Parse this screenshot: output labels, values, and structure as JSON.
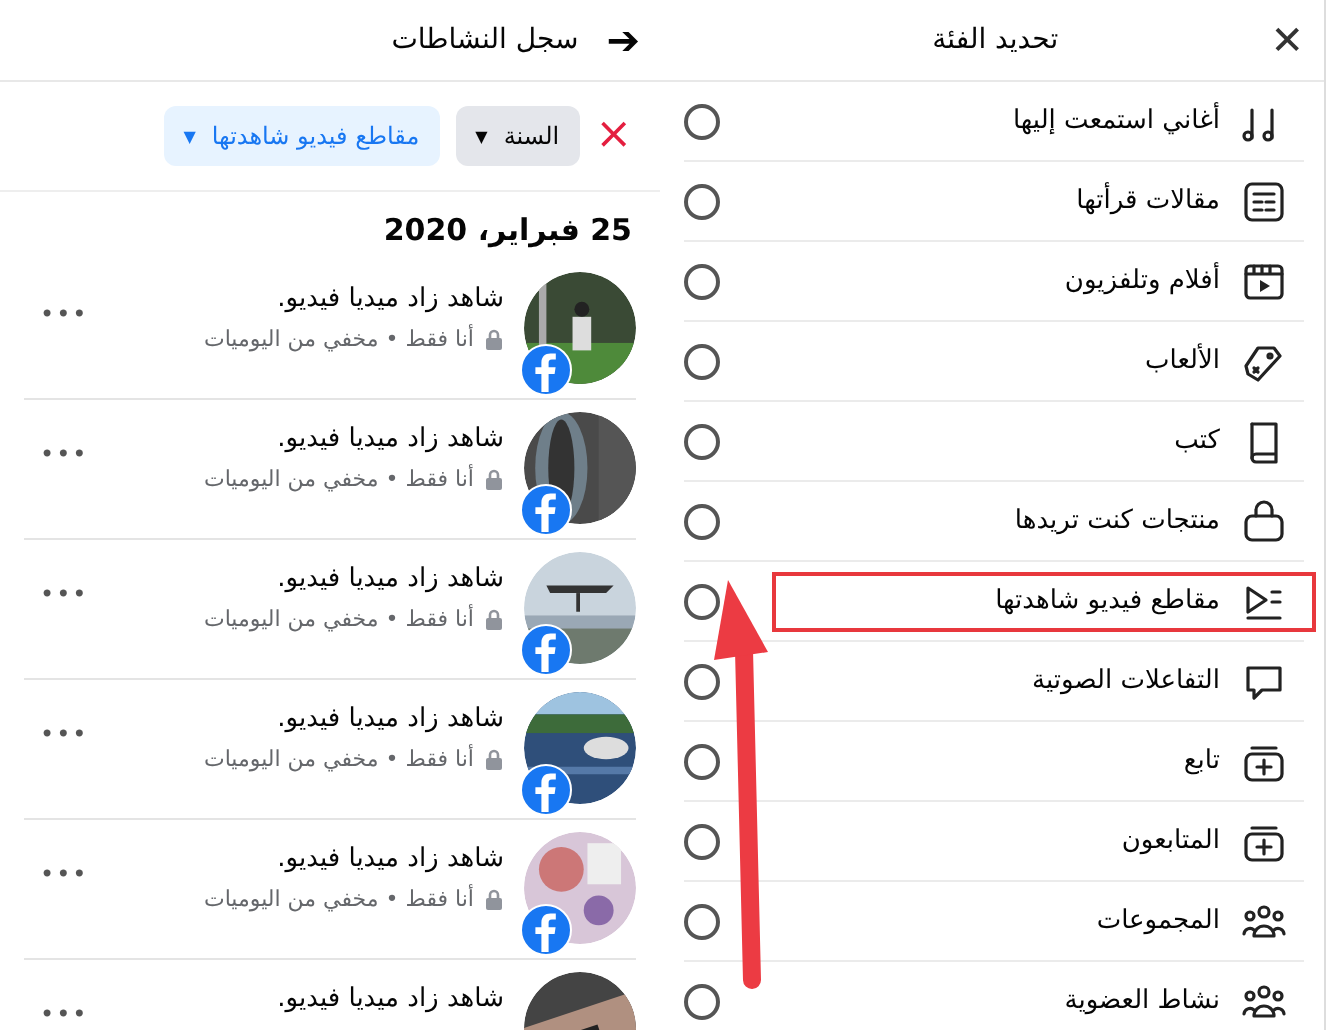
{
  "activity_log": {
    "title": "سجل النشاطات",
    "back": "➔",
    "filters": {
      "clear": "×",
      "chips": [
        {
          "label": "السنة",
          "selected": false
        },
        {
          "label": "مقاطع فيديو شاهدتها",
          "selected": true
        }
      ],
      "caret": "▼"
    },
    "date": "25 فبراير، 2020",
    "entries": [
      {
        "title": "شاهد زاد ميديا فيديو.",
        "audience": "أنا فقط • مخفي من اليوميات",
        "more": "•••"
      },
      {
        "title": "شاهد زاد ميديا فيديو.",
        "audience": "أنا فقط • مخفي من اليوميات",
        "more": "•••"
      },
      {
        "title": "شاهد زاد ميديا فيديو.",
        "audience": "أنا فقط • مخفي من اليوميات",
        "more": "•••"
      },
      {
        "title": "شاهد زاد ميديا فيديو.",
        "audience": "أنا فقط • مخفي من اليوميات",
        "more": "•••"
      },
      {
        "title": "شاهد زاد ميديا فيديو.",
        "audience": "أنا فقط • مخفي من اليوميات",
        "more": "•••"
      },
      {
        "title": "شاهد زاد ميديا فيديو.",
        "more": "•••",
        "badge": false
      }
    ]
  },
  "category_picker": {
    "title": "تحديد الفئة",
    "close": "✕",
    "items": [
      {
        "label": "أغاني استمعت إليها",
        "selected": false,
        "highlighted": false
      },
      {
        "label": "مقالات قرأتها",
        "selected": false,
        "highlighted": false
      },
      {
        "label": "أفلام وتلفزيون",
        "selected": false,
        "highlighted": false
      },
      {
        "label": "الألعاب",
        "selected": false,
        "highlighted": false
      },
      {
        "label": "كتب",
        "selected": false,
        "highlighted": false
      },
      {
        "label": "منتجات كنت تريدها",
        "selected": false,
        "highlighted": false
      },
      {
        "label": "مقاطع فيديو شاهدتها",
        "selected": false,
        "highlighted": true
      },
      {
        "label": "التفاعلات الصوتية",
        "selected": false,
        "highlighted": false
      },
      {
        "label": "تابع",
        "selected": false,
        "highlighted": false
      },
      {
        "label": "المتابعون",
        "selected": false,
        "highlighted": false
      },
      {
        "label": "المجموعات",
        "selected": false,
        "highlighted": false
      },
      {
        "label": "نشاط العضوية",
        "selected": false,
        "highlighted": false
      }
    ]
  }
}
